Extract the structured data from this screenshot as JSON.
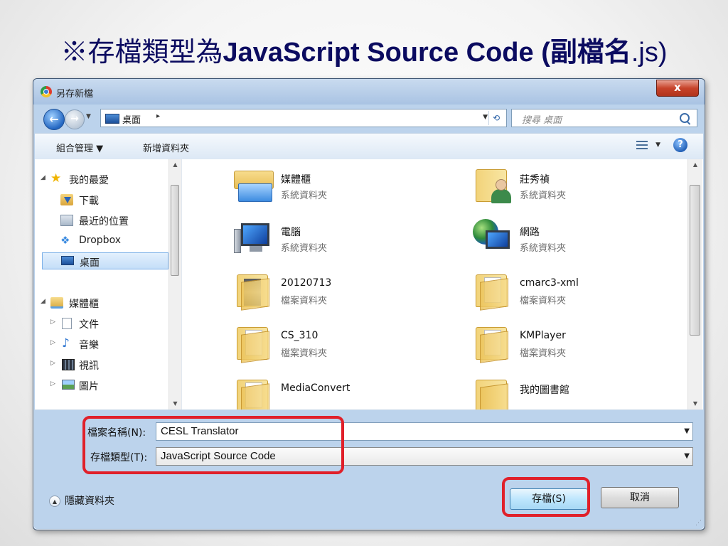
{
  "slide": {
    "title_prefix": "※存檔類型為",
    "title_bold": "JavaScript Source Code (",
    "title_mid": "副檔名",
    "title_end": ".js)"
  },
  "dialog": {
    "title": "另存新檔",
    "close_label": "x",
    "address": {
      "location": "桌面",
      "separator": "▸"
    },
    "search_placeholder": "搜尋 桌面",
    "toolbar": {
      "organize": "組合管理 ▼",
      "new_folder": "新增資料夾"
    },
    "nav": {
      "favorites": "我的最愛",
      "downloads": "下載",
      "recent": "最近的位置",
      "dropbox": "Dropbox",
      "desktop": "桌面",
      "libraries": "媒體櫃",
      "documents": "文件",
      "music": "音樂",
      "videos": "視訊",
      "pictures": "圖片"
    },
    "files": [
      {
        "name": "媒體櫃",
        "type": "系統資料夾",
        "icon": "library-icon"
      },
      {
        "name": "莊秀禎",
        "type": "系統資料夾",
        "icon": "user-folder-icon"
      },
      {
        "name": "電腦",
        "type": "系統資料夾",
        "icon": "computer-icon"
      },
      {
        "name": "網路",
        "type": "系統資料夾",
        "icon": "network-icon"
      },
      {
        "name": "20120713",
        "type": "檔案資料夾",
        "icon": "folder-icon"
      },
      {
        "name": "cmarc3-xml",
        "type": "檔案資料夾",
        "icon": "folder-icon"
      },
      {
        "name": "CS_310",
        "type": "檔案資料夾",
        "icon": "folder-icon"
      },
      {
        "name": "KMPlayer",
        "type": "檔案資料夾",
        "icon": "folder-icon"
      },
      {
        "name": "MediaConvert",
        "type": "",
        "icon": "folder-icon"
      },
      {
        "name": "我的圖書館",
        "type": "",
        "icon": "folder-icon"
      }
    ],
    "filename_label": "檔案名稱(N):",
    "filename_value": "CESL Translator",
    "filetype_label": "存檔類型(T):",
    "filetype_value": "JavaScript Source Code",
    "hide_folders": "隱藏資料夾",
    "save_label": "存檔(S)",
    "cancel_label": "取消",
    "highlight_color": "#e0202a"
  }
}
